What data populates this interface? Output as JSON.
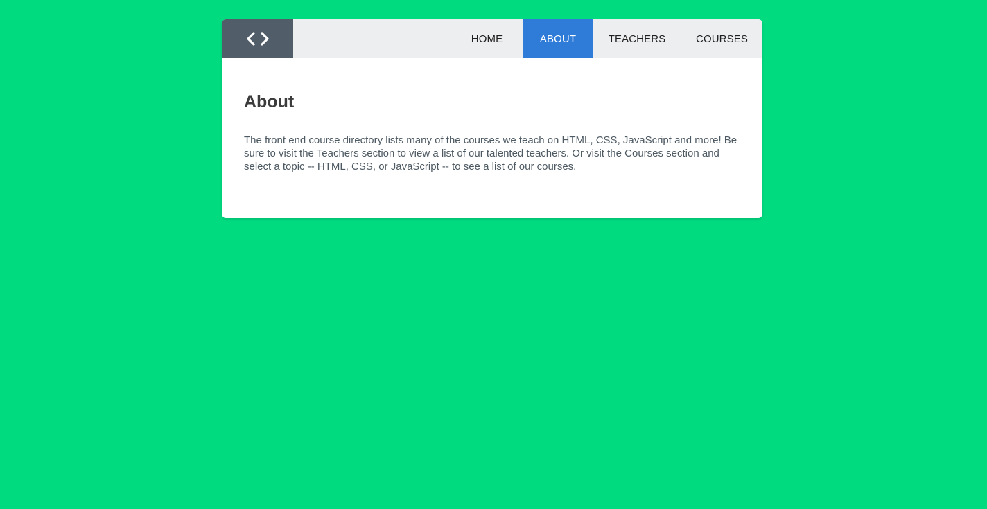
{
  "colors": {
    "background": "#00db80",
    "card": "#ffffff",
    "header": "#edeef0",
    "logo_bg": "#515e69",
    "active_nav": "#2f7bd8",
    "heading_text": "#3c3c3c",
    "body_text": "#4e5a63"
  },
  "header": {
    "logo_icon": "code-brackets-icon",
    "nav": [
      {
        "label": "HOME",
        "active": false
      },
      {
        "label": "ABOUT",
        "active": true
      },
      {
        "label": "TEACHERS",
        "active": false
      },
      {
        "label": "COURSES",
        "active": false
      }
    ]
  },
  "main": {
    "title": "About",
    "paragraph": "The front end course directory lists many of the courses we teach on HTML, CSS, JavaScript and more! Be sure to visit the Teachers section to view a list of our talented teachers. Or visit the Courses section and select a topic -- HTML, CSS, or JavaScript -- to see a list of our courses."
  }
}
